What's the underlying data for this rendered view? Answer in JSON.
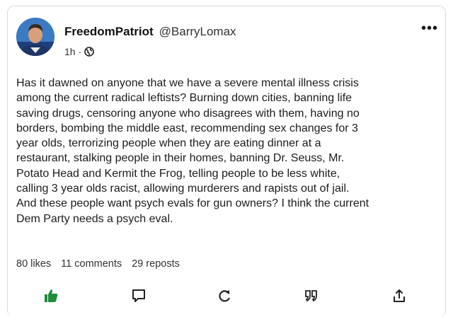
{
  "post": {
    "display_name": "FreedomPatriot",
    "handle": "@BarryLomax",
    "time": "1h",
    "separator": "·",
    "visibility_icon": "globe-icon",
    "more_label": "•••",
    "text": "Has it dawned on anyone that we have a severe mental illness crisis\namong the current radical leftists? Burning down cities, banning life\nsaving drugs, censoring anyone who disagrees with them, having no\nborders, bombing the middle east, recommending sex changes for 3\nyear olds, terrorizing people when they are eating dinner at a\nrestaurant, stalking people in their homes, banning Dr. Seuss, Mr.\nPotato Head and Kermit the Frog, telling people to be less white,\ncalling 3 year olds racist, allowing murderers and rapists out of jail.\nAnd these people want psych evals for gun owners? I think the current\nDem Party needs a psych eval."
  },
  "stats": {
    "likes": "80 likes",
    "comments": "11 comments",
    "reposts": "29 reposts"
  },
  "actions": {
    "like_icon": "thumbs-up-icon",
    "comment_icon": "comment-icon",
    "repost_icon": "repost-icon",
    "quote_icon": "quote-icon",
    "share_icon": "share-icon",
    "like_color": "#1e8c3a"
  }
}
